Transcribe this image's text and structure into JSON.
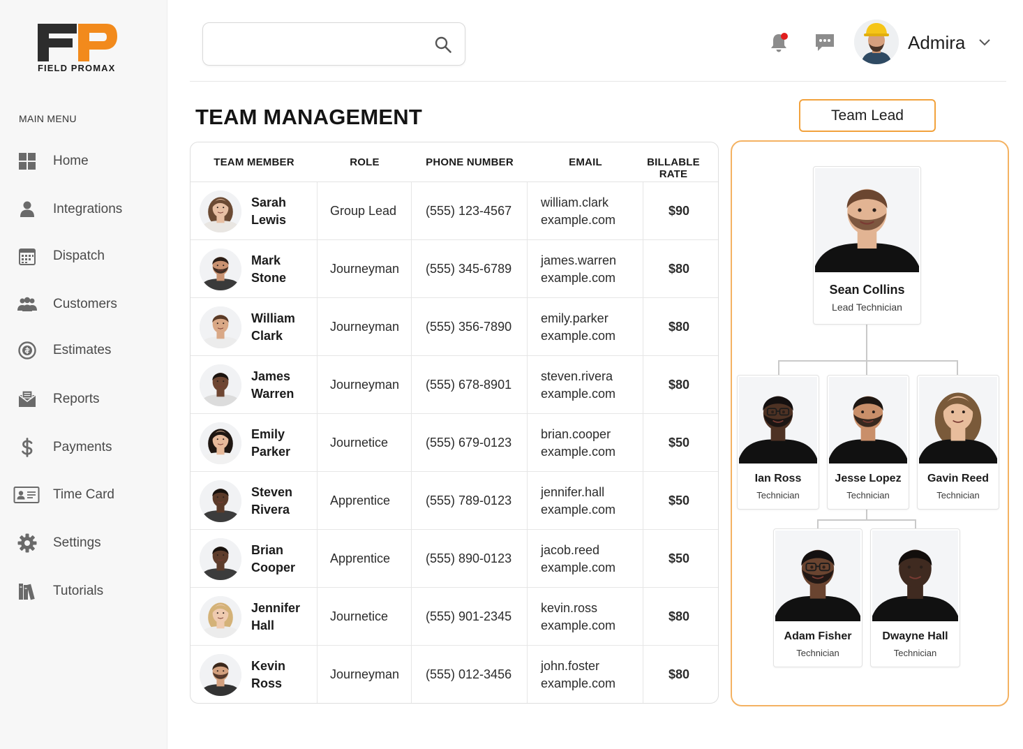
{
  "brand": {
    "logo_letters": "FP",
    "logo_text_left": "FIELD",
    "logo_text_right": "PROMAX",
    "accent_color": "#f28a1c",
    "dark_color": "#2d2d2d"
  },
  "sidebar": {
    "menu_title": "MAIN MENU",
    "items": [
      {
        "label": "Home",
        "icon": "grid-icon"
      },
      {
        "label": "Integrations",
        "icon": "person-icon"
      },
      {
        "label": "Dispatch",
        "icon": "calendar-icon"
      },
      {
        "label": "Customers",
        "icon": "group-icon"
      },
      {
        "label": "Estimates",
        "icon": "estimate-icon"
      },
      {
        "label": "Reports",
        "icon": "envelope-icon"
      },
      {
        "label": "Payments",
        "icon": "dollar-icon"
      },
      {
        "label": "Time Card",
        "icon": "id-card-icon"
      },
      {
        "label": "Settings",
        "icon": "gear-icon"
      },
      {
        "label": "Tutorials",
        "icon": "books-icon"
      }
    ]
  },
  "header": {
    "search_value": "",
    "search_placeholder": "",
    "user_name": "Admira",
    "notification_dot_color": "#e11d1d"
  },
  "page": {
    "title": "TEAM MANAGEMENT"
  },
  "table": {
    "columns": [
      "TEAM MEMBER",
      "ROLE",
      "PHONE NUMBER",
      "EMAIL",
      "BILLABLE RATE"
    ],
    "rows": [
      {
        "name": "Sarah\nLewis",
        "role": "Group Lead",
        "phone": "(555) 123-4567",
        "email": "william.clark\nexample.com",
        "rate": "$90"
      },
      {
        "name": "Mark\nStone",
        "role": "Journeyman",
        "phone": "(555) 345-6789",
        "email": "james.warren\nexample.com",
        "rate": "$80"
      },
      {
        "name": "William\nClark",
        "role": "Journeyman",
        "phone": "(555) 356-7890",
        "email": "emily.parker\nexample.com",
        "rate": "$80"
      },
      {
        "name": "James\nWarren",
        "role": "Journeyman",
        "phone": "(555) 678-8901",
        "email": "steven.rivera\nexample.com",
        "rate": "$80"
      },
      {
        "name": "Emily\nParker",
        "role": "Journetice",
        "phone": "(555) 679-0123",
        "email": "brian.cooper\nexample.com",
        "rate": "$50"
      },
      {
        "name": "Steven\nRivera",
        "role": "Apprentice",
        "phone": "(555) 789-0123",
        "email": "jennifer.hall\nexample.com",
        "rate": "$50"
      },
      {
        "name": "Brian\nCooper",
        "role": "Apprentice",
        "phone": "(555) 890-0123",
        "email": "jacob.reed\nexample.com",
        "rate": "$50"
      },
      {
        "name": "Jennifer\nHall",
        "role": "Journetice",
        "phone": "(555) 901-2345",
        "email": "kevin.ross\nexample.com",
        "rate": "$80"
      },
      {
        "name": "Kevin\nRoss",
        "role": "Journeyman",
        "phone": "(555) 012-3456",
        "email": "john.foster\nexample.com",
        "rate": "$80"
      }
    ]
  },
  "org": {
    "button_label": "Team Lead",
    "lead": {
      "name": "Sean Collins",
      "role": "Lead Technician"
    },
    "level2": [
      {
        "name": "Ian Ross",
        "role": "Technician"
      },
      {
        "name": "Jesse Lopez",
        "role": "Technician"
      },
      {
        "name": "Gavin Reed",
        "role": "Technician"
      }
    ],
    "level3": [
      {
        "name": "Adam Fisher",
        "role": "Technician"
      },
      {
        "name": "Dwayne Hall",
        "role": "Technician"
      }
    ],
    "accent_color": "#f4b262"
  }
}
